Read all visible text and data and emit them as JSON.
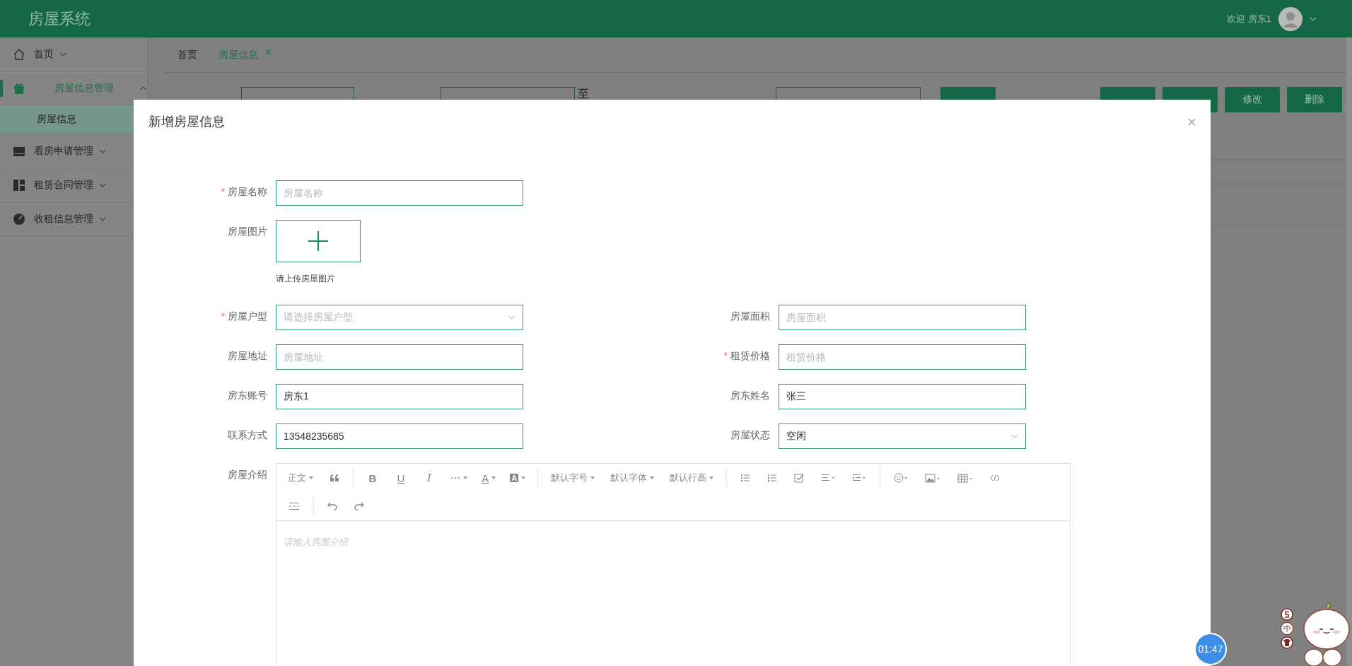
{
  "header": {
    "title": "房屋系统",
    "welcome": "欢迎 房东1"
  },
  "sidebar": {
    "items": [
      {
        "label": "首页",
        "selected": false,
        "expanded": false
      },
      {
        "label": "房屋信息管理",
        "selected": true,
        "expanded": true,
        "children": [
          {
            "label": "房屋信息",
            "selected": true
          }
        ]
      },
      {
        "label": "看房申请管理",
        "selected": false,
        "expanded": false
      },
      {
        "label": "租赁合同管理",
        "selected": false,
        "expanded": false
      },
      {
        "label": "收租信息管理",
        "selected": false,
        "expanded": false
      }
    ]
  },
  "tabs": [
    {
      "label": "首页",
      "selected": false,
      "closable": false
    },
    {
      "label": "房屋信息",
      "selected": true,
      "closable": true
    }
  ],
  "search": {
    "range_separator": "至"
  },
  "actions": [
    {
      "label": "修改"
    },
    {
      "label": "删除"
    }
  ],
  "dialog": {
    "title": "新增房屋信息",
    "required_mark": "*",
    "rows": [
      {
        "left": {
          "kind": "input",
          "label": "房屋名称",
          "required": true,
          "placeholder": "房屋名称"
        }
      },
      {
        "left": {
          "kind": "upload",
          "label": "房屋图片",
          "required": false,
          "hint": "请上传房屋图片"
        }
      },
      {
        "left": {
          "kind": "select",
          "label": "房屋户型",
          "required": true,
          "placeholder": "请选择房屋户型"
        },
        "right": {
          "kind": "input",
          "label": "房屋面积",
          "required": false,
          "placeholder": "房屋面积"
        }
      },
      {
        "left": {
          "kind": "input",
          "label": "房屋地址",
          "required": false,
          "placeholder": "房屋地址"
        },
        "right": {
          "kind": "input",
          "label": "租赁价格",
          "required": true,
          "placeholder": "租赁价格"
        }
      },
      {
        "left": {
          "kind": "input",
          "label": "房东账号",
          "required": false,
          "value": "房东1"
        },
        "right": {
          "kind": "input",
          "label": "房东姓名",
          "required": false,
          "value": "张三"
        }
      },
      {
        "left": {
          "kind": "input",
          "label": "联系方式",
          "required": false,
          "value": "13548235685"
        },
        "right": {
          "kind": "select",
          "label": "房屋状态",
          "required": false,
          "value": "空闲"
        }
      }
    ],
    "editor": {
      "label": "房屋介绍",
      "placeholder": "请输入房屋介绍",
      "style_menu": "正文",
      "glyphs": {
        "bold": "B",
        "underline": "U",
        "italic": "I",
        "more": "···",
        "font_color": "A",
        "back_color": "A"
      },
      "font_menus": [
        "默认字号",
        "默认字体",
        "默认行高"
      ]
    }
  },
  "widgets": {
    "timer": "01:47",
    "sticker_mark": "中"
  }
}
